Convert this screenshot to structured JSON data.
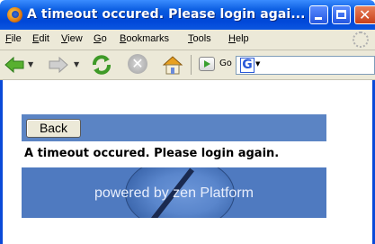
{
  "window": {
    "title": "A timeout occured. Please login agai..."
  },
  "menu": [
    {
      "label": "File",
      "underline": "F"
    },
    {
      "label": "Edit",
      "underline": "E"
    },
    {
      "label": "View",
      "underline": "V"
    },
    {
      "label": "Go",
      "underline": "G"
    },
    {
      "label": "Bookmarks",
      "underline": "B"
    },
    {
      "label": "Tools",
      "underline": "T"
    },
    {
      "label": "Help",
      "underline": "H"
    }
  ],
  "toolbar": {
    "icons": [
      "back-arrow-icon",
      "forward-arrow-icon",
      "reload-icon",
      "stop-icon",
      "home-icon",
      "go-icon",
      "search-engine-icon"
    ],
    "go_label": "Go",
    "search_engine": "G"
  },
  "page": {
    "back_button": "Back",
    "message": "A timeout occured. Please login again.",
    "footer_text": "powered by zen Platform"
  },
  "colors": {
    "titlebar": "#0a5ce0",
    "band": "#5b84c4",
    "footer": "#4f7ac0"
  }
}
